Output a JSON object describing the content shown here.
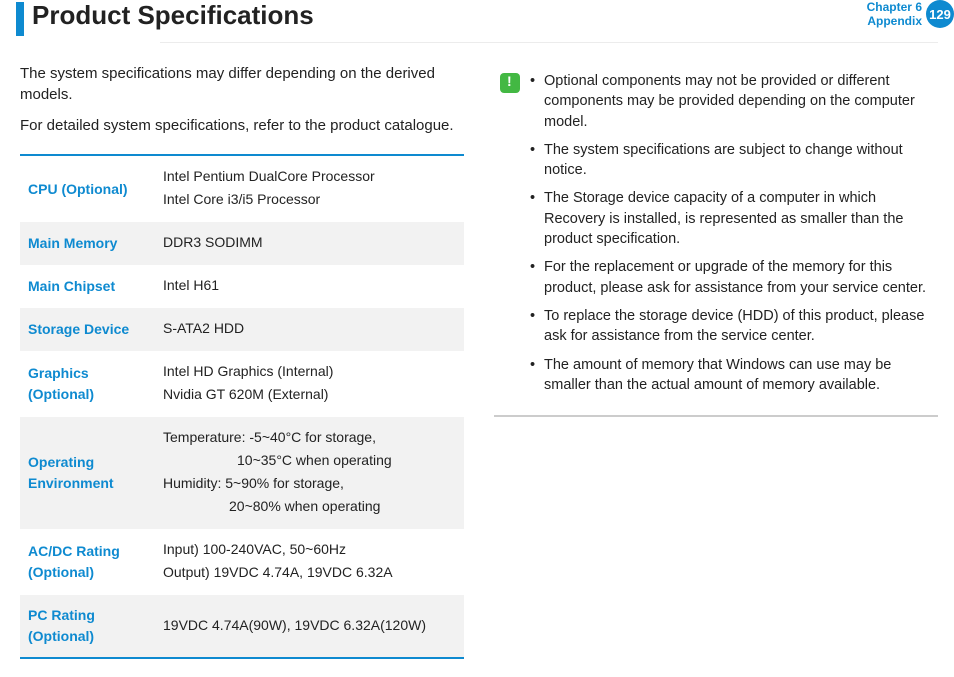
{
  "header": {
    "title": "Product Specifications",
    "chapter_line1": "Chapter 6",
    "chapter_line2": "Appendix",
    "page_number": "129"
  },
  "intro": {
    "p1": "The system specifications may differ depending on the derived models.",
    "p2": "For detailed system specifications, refer to the product catalogue."
  },
  "specs": [
    {
      "label": "CPU (Optional)",
      "lines": [
        "Intel Pentium DualCore Processor",
        "Intel Core i3/i5 Processor"
      ]
    },
    {
      "label": "Main Memory",
      "lines": [
        "DDR3 SODIMM"
      ]
    },
    {
      "label": "Main Chipset",
      "lines": [
        "Intel H61"
      ]
    },
    {
      "label": "Storage Device",
      "lines": [
        "S-ATA2 HDD"
      ]
    },
    {
      "label": "Graphics (Optional)",
      "lines": [
        "Intel HD Graphics (Internal)",
        "Nvidia GT 620M (External)"
      ]
    },
    {
      "label": "Operating Environment",
      "lines": [
        "Temperature: -5~40°C for storage,",
        "INDENT1:10~35°C when operating",
        "Humidity: 5~90% for storage,",
        "INDENT2:20~80% when operating"
      ]
    },
    {
      "label": "AC/DC Rating (Optional)",
      "lines": [
        "Input) 100-240VAC, 50~60Hz",
        "Output) 19VDC 4.74A, 19VDC 6.32A"
      ]
    },
    {
      "label": "PC Rating (Optional)",
      "lines": [
        "19VDC 4.74A(90W), 19VDC 6.32A(120W)"
      ]
    }
  ],
  "notes": [
    "Optional components may not be provided or different components may be provided depending on the computer model.",
    "The system specifications are subject to change without notice.",
    "The Storage device capacity of a computer in which Recovery is installed, is represented as smaller than the product specification.",
    "For the replacement or upgrade of the memory for this product, please ask for assistance from your service center.",
    "To replace the storage device (HDD) of this product, please ask for assistance from the service center.",
    "The amount of memory that Windows can use may be smaller than the actual amount of memory available."
  ]
}
